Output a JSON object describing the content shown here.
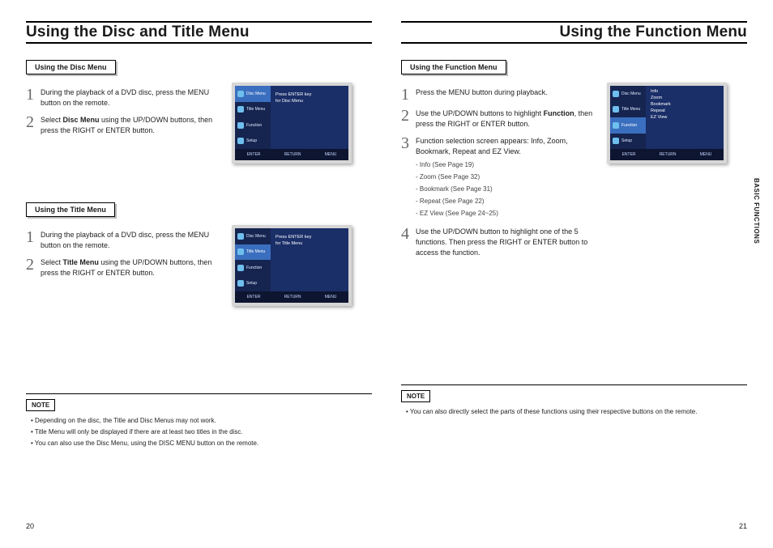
{
  "left": {
    "title": "Using the Disc and Title Menu",
    "pageNumber": "20",
    "sec1": {
      "label": "Using the Disc Menu",
      "step1": "During the playback of a DVD disc, press the MENU button on the remote.",
      "step2_a": "Select ",
      "step2_b": "Disc Menu",
      "step2_c": " using the UP/DOWN buttons, then press the RIGHT or ENTER button."
    },
    "sec2": {
      "label": "Using the Title Menu",
      "step1": "During the playback of a DVD disc, press the MENU button on the remote.",
      "step2_a": "Select ",
      "step2_b": "Title Menu",
      "step2_c": " using the UP/DOWN buttons, then press the RIGHT or ENTER button."
    },
    "noteLabel": "NOTE",
    "notes": [
      "Depending on the disc, the Title and Disc Menus may not work.",
      "Title Menu will only be displayed if there are at least two titles in the disc.",
      "You can also use the Disc Menu, using the DISC MENU button on the remote."
    ],
    "ill1": {
      "side": [
        "Disc Menu",
        "Title Menu",
        "Function",
        "Setup"
      ],
      "selIndex": 0,
      "main1": "Press ENTER key",
      "main2": "for Disc Menu",
      "foot": [
        "ENTER",
        "RETURN",
        "MENU"
      ]
    },
    "ill2": {
      "side": [
        "Disc Menu",
        "Title Menu",
        "Function",
        "Setup"
      ],
      "selIndex": 1,
      "main1": "Press ENTER key",
      "main2": "for Title Menu",
      "foot": [
        "ENTER",
        "RETURN",
        "MENU"
      ]
    }
  },
  "right": {
    "title": "Using the Function Menu",
    "pageNumber": "21",
    "sideTab": "BASIC FUNCTIONS",
    "sec1": {
      "label": "Using the Function Menu",
      "step1": "Press the MENU button during playback.",
      "step2_a": "Use the UP/DOWN buttons to highlight ",
      "step2_b": "Function",
      "step2_c": ", then press the RIGHT or ENTER button.",
      "step3": "Function selection screen appears: Info, Zoom, Bookmark, Repeat and EZ View.",
      "step3_list": [
        "Info (See Page 19)",
        "Zoom (See Page 32)",
        "Bookmark (See Page 31)",
        "Repeat (See Page 22)",
        "EZ View (See Page 24~25)"
      ],
      "step4": "Use the UP/DOWN button to highlight one of the 5 functions. Then press the RIGHT or ENTER button to access the function."
    },
    "noteLabel": "NOTE",
    "notes": [
      "You can also directly select the parts of these functions using their respective buttons on the remote."
    ],
    "ill": {
      "side": [
        "Disc Menu",
        "Title Menu",
        "Function",
        "Setup"
      ],
      "selIndex": 2,
      "list": [
        "Info",
        "Zoom",
        "Bookmark",
        "Repeat",
        "EZ View"
      ],
      "foot": [
        "ENTER",
        "RETURN",
        "MENU"
      ]
    }
  }
}
